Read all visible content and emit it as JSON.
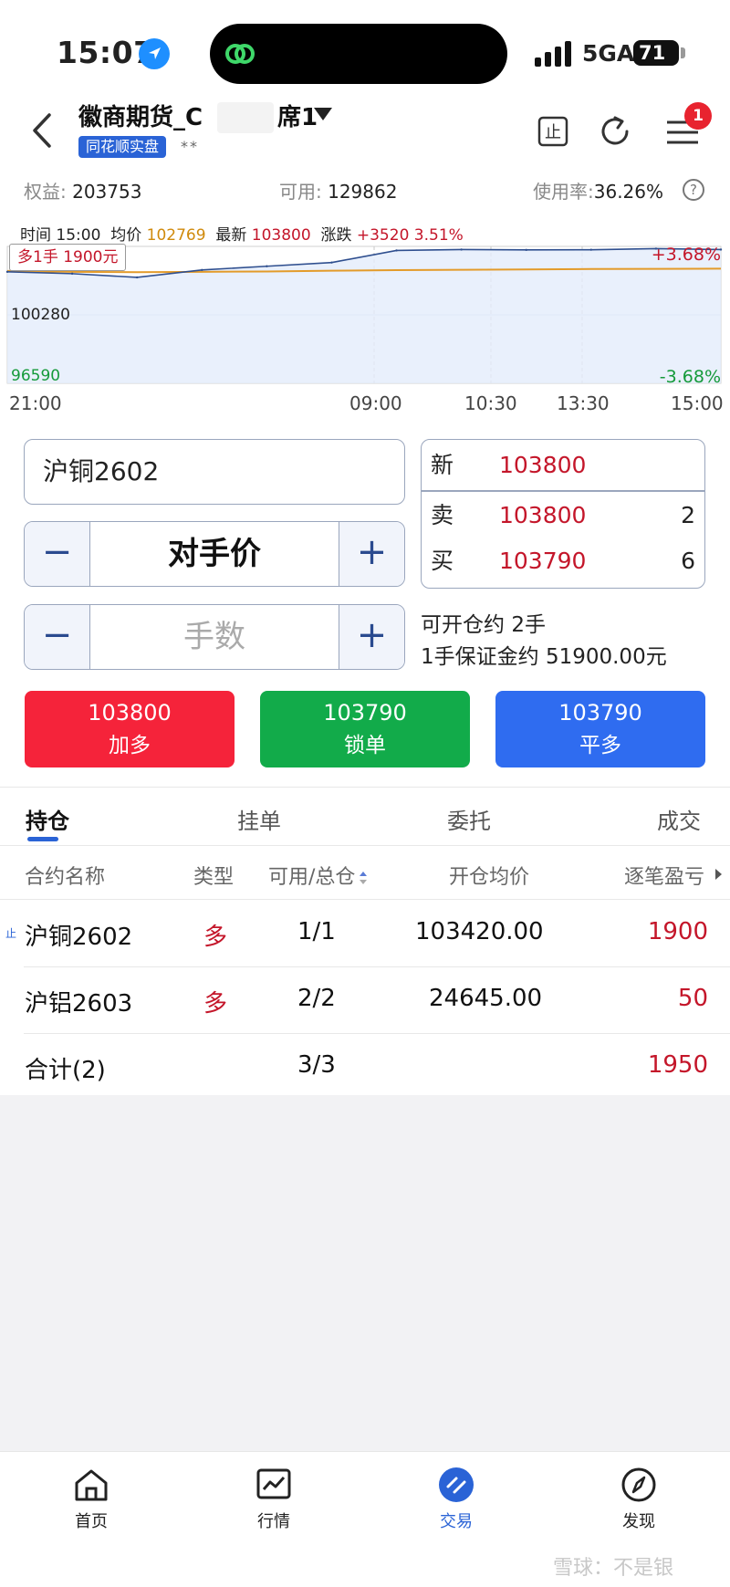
{
  "status_bar": {
    "time": "15:07",
    "network": "5GA",
    "battery": "71"
  },
  "header": {
    "account_name": "徽商期货_C",
    "account_suffix": "席1",
    "tag": "同花顺实盘",
    "stars": "**",
    "stop_icon_label": "止",
    "notification_count": "1"
  },
  "summary": {
    "equity_label": "权益:",
    "equity": "203753",
    "available_label": "可用:",
    "available": "129862",
    "usage_label": "使用率:",
    "usage": "36.26%",
    "help": "?"
  },
  "chart": {
    "time_label": "时间",
    "time": "15:00",
    "avg_label": "均价",
    "avg": "102769",
    "last_label": "最新",
    "last": "103800",
    "change_label": "涨跌",
    "change": "+3520 3.51%",
    "position_label": "多1手 1900元",
    "y_mid": "100280",
    "y_low": "96590",
    "y_up_pct": "+3.68%",
    "y_low_pct": "-3.68%",
    "x_ticks": [
      "21:00",
      "09:00",
      "10:30",
      "13:30",
      "15:00"
    ]
  },
  "chart_data": {
    "type": "line",
    "x": [
      "21:00",
      "09:00",
      "10:30",
      "13:30",
      "15:00"
    ],
    "ylim": [
      96590,
      103970
    ],
    "series": [
      {
        "name": "最新",
        "values": [
          102600,
          102500,
          102300,
          102700,
          102900,
          103100,
          103750,
          103800,
          103780,
          103790,
          103850,
          103800
        ]
      },
      {
        "name": "均价",
        "values": [
          102650,
          102600,
          102580,
          102600,
          102620,
          102660,
          102690,
          102710,
          102730,
          102750,
          102760,
          102769
        ]
      }
    ],
    "grid": true
  },
  "order": {
    "contract": "沪铜2602",
    "price_type": "对手价",
    "qty_placeholder": "手数",
    "minus": "−",
    "plus": "+",
    "quote": [
      {
        "k": "新",
        "p": "103800",
        "n": ""
      },
      {
        "k": "卖",
        "p": "103800",
        "n": "2"
      },
      {
        "k": "买",
        "p": "103790",
        "n": "6"
      }
    ],
    "openable_label": "可开仓约",
    "openable": "2手",
    "margin_label": "1手保证金约",
    "margin": "51900.00元"
  },
  "actions": [
    {
      "price": "103800",
      "label": "加多",
      "color": "#f5233a"
    },
    {
      "price": "103790",
      "label": "锁单",
      "color": "#12ab4a"
    },
    {
      "price": "103790",
      "label": "平多",
      "color": "#2f6cf0"
    }
  ],
  "tabs": [
    "持仓",
    "挂单",
    "委托",
    "成交"
  ],
  "table": {
    "headers": [
      "合约名称",
      "类型",
      "可用/总仓",
      "开仓均价",
      "逐笔盈亏"
    ],
    "rows": [
      {
        "name": "沪铜2602",
        "type": "多",
        "qty": "1/1",
        "avg": "103420.00",
        "pnl": "1900"
      },
      {
        "name": "沪铝2603",
        "type": "多",
        "qty": "2/2",
        "avg": "24645.00",
        "pnl": "50"
      }
    ],
    "total": {
      "name": "合计(2)",
      "qty": "3/3",
      "pnl": "1950"
    }
  },
  "nav": [
    "首页",
    "行情",
    "交易",
    "发现"
  ],
  "watermark": "雪球：不是银"
}
